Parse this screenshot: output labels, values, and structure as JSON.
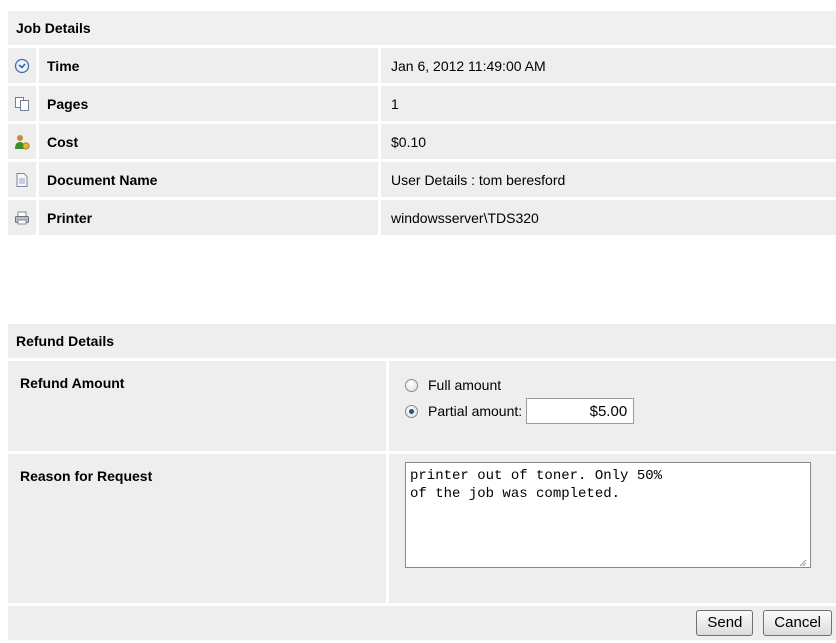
{
  "job": {
    "title": "Job Details",
    "rows": [
      {
        "icon": "clock-icon",
        "label": "Time",
        "value": "Jan 6, 2012 11:49:00 AM"
      },
      {
        "icon": "pages-icon",
        "label": "Pages",
        "value": "1"
      },
      {
        "icon": "cost-icon",
        "label": "Cost",
        "value": "$0.10"
      },
      {
        "icon": "document-icon",
        "label": "Document Name",
        "value": "User Details : tom beresford"
      },
      {
        "icon": "printer-icon",
        "label": "Printer",
        "value": "windowsserver\\TDS320"
      }
    ]
  },
  "refund": {
    "title": "Refund Details",
    "amount_label": "Refund Amount",
    "full_label": "Full amount",
    "partial_label": "Partial amount:",
    "partial_value": "$5.00",
    "selected": "partial",
    "reason_label": "Reason for Request",
    "reason_value": "printer out of toner. Only 50%\nof the job was completed."
  },
  "buttons": {
    "send": "Send",
    "cancel": "Cancel"
  }
}
